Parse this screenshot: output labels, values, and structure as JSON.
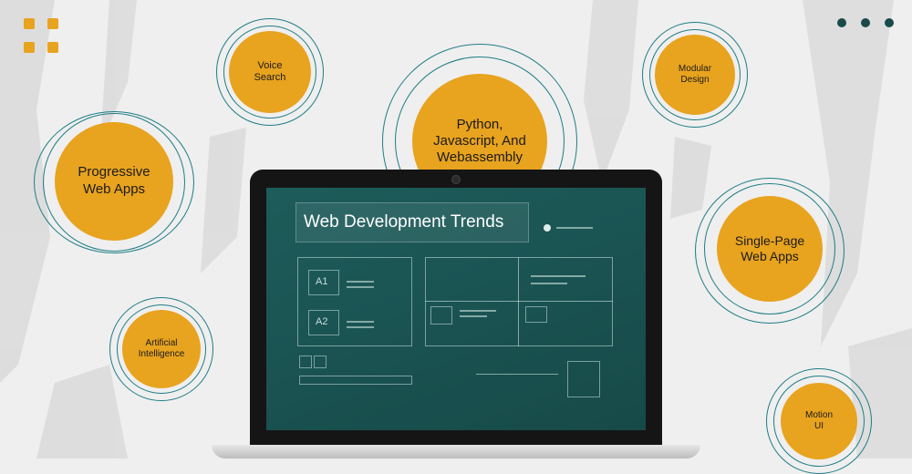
{
  "bubbles": {
    "voice_search": "Voice\nSearch",
    "python": "Python,\nJavascript, And\nWebassembly",
    "modular": "Modular\nDesign",
    "pwa": "Progressive\nWeb Apps",
    "spa": "Single-Page\nWeb Apps",
    "ai": "Artificial\nIntelligence",
    "motion": "Motion\nUI"
  },
  "screen": {
    "title": "Web Development Trends",
    "a1": "A1",
    "a2": "A2"
  },
  "colors": {
    "accent": "#e8a31f",
    "ring": "#1f7d86",
    "screen": "#1a5352",
    "dots": "#1a4a4a"
  }
}
